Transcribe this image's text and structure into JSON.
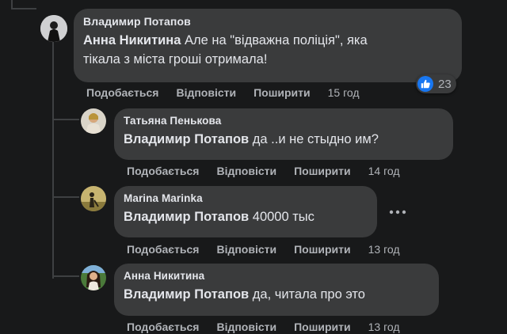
{
  "actions": {
    "like": "Подобається",
    "reply": "Відповісти",
    "share": "Поширити"
  },
  "comments": [
    {
      "author": "Владимир Потапов",
      "mention": "Анна Никитина",
      "text_line1": " Але на \"відважна поліція\", яка",
      "text_line2": "тікала з міста гроші отримала!",
      "time": "15 год",
      "reactions": {
        "icon": "like-icon",
        "count": "23"
      }
    },
    {
      "author": "Татьяна Пенькова",
      "mention": "Владимир Потапов",
      "text": " да ..и не стыдно им?",
      "time": "14 год"
    },
    {
      "author": "Marina Marinka",
      "mention": "Владимир Потапов",
      "text": " 40000 тыс",
      "time": "13 год"
    },
    {
      "author": "Анна Никитина",
      "mention": "Владимир Потапов",
      "text": " да, читала про это",
      "time": "13 год"
    }
  ],
  "colors": {
    "background": "#18191a",
    "bubble": "#3a3b3c",
    "text": "#e4e6eb",
    "muted": "#b0b3b8",
    "like_blue": "#1877f2"
  }
}
